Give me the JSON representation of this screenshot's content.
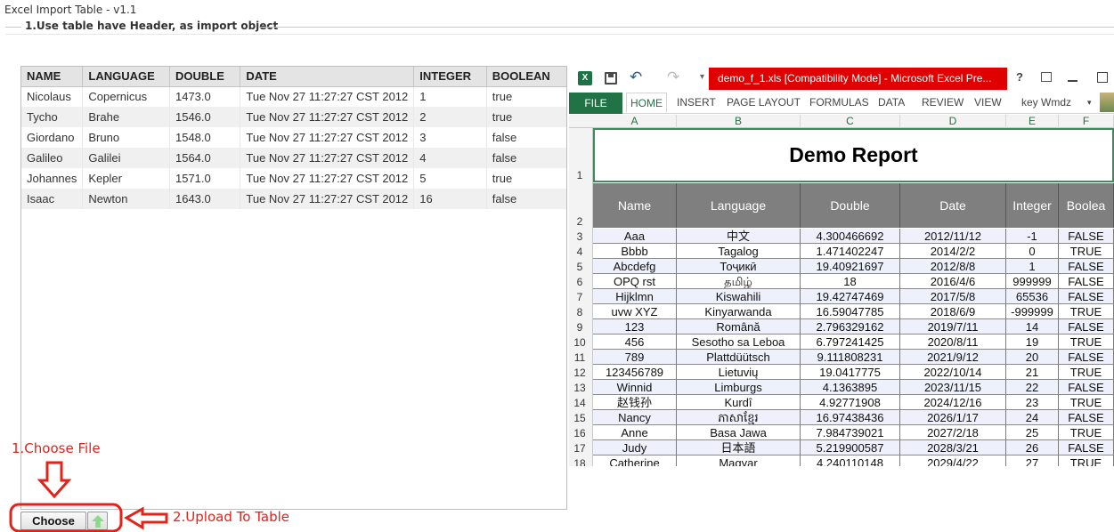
{
  "window": {
    "title": "Excel Import Table - v1.1"
  },
  "group": {
    "legend": "1.Use table have Header, as import object"
  },
  "table": {
    "columns": [
      "NAME",
      "LANGUAGE",
      "DOUBLE",
      "DATE",
      "INTEGER",
      "BOOLEAN"
    ],
    "rows": [
      [
        "Nicolaus",
        "Copernicus",
        "1473.0",
        "Tue Nov 27 11:27:27 CST 2012",
        "1",
        "true"
      ],
      [
        "Tycho",
        "Brahe",
        "1546.0",
        "Tue Nov 27 11:27:27 CST 2012",
        "2",
        "true"
      ],
      [
        "Giordano",
        "Bruno",
        "1548.0",
        "Tue Nov 27 11:27:27 CST 2012",
        "3",
        "false"
      ],
      [
        "Galileo",
        "Galilei",
        "1564.0",
        "Tue Nov 27 11:27:27 CST 2012",
        "4",
        "false"
      ],
      [
        "Johannes",
        "Kepler",
        "1571.0",
        "Tue Nov 27 11:27:27 CST 2012",
        "5",
        "true"
      ],
      [
        "Isaac",
        "Newton",
        "1643.0",
        "Tue Nov 27 11:27:27 CST 2012",
        "16",
        "false"
      ]
    ]
  },
  "buttons": {
    "choose_label": "Choose",
    "upload_icon": "upload-arrow-icon"
  },
  "annotations": {
    "choose_file": "1.Choose File",
    "upload_to_table": "2.Upload To Table"
  },
  "excel": {
    "title": "demo_f_1.xls  [Compatibility Mode] - Microsoft Excel Pre...",
    "help": "?",
    "ribbon_tabs": [
      "FILE",
      "HOME",
      "INSERT",
      "PAGE LAYOUT",
      "FORMULAS",
      "DATA",
      "REVIEW",
      "VIEW"
    ],
    "user": "key Wmdz",
    "column_letters": [
      "A",
      "B",
      "C",
      "D",
      "E",
      "F"
    ],
    "report_title": "Demo Report",
    "headers": [
      "Name",
      "Language",
      "Double",
      "Date",
      "Integer",
      "Boolea"
    ],
    "row_numbers": [
      "1",
      "2",
      "3",
      "4",
      "5",
      "6",
      "7",
      "8",
      "9",
      "10",
      "11",
      "12",
      "13",
      "14",
      "15",
      "16",
      "17",
      "18"
    ],
    "rows": [
      [
        "Aaa",
        "中文",
        "4.300466692",
        "2012/11/12",
        "-1",
        "FALSE"
      ],
      [
        "Bbbb",
        "Tagalog",
        "1.471402247",
        "2014/2/2",
        "0",
        "TRUE"
      ],
      [
        "Abcdefg",
        "Тоҷикӣ",
        "19.40921697",
        "2012/8/8",
        "1",
        "FALSE"
      ],
      [
        "OPQ rst",
        "தமிழ்",
        "18",
        "2016/4/6",
        "999999",
        "FALSE"
      ],
      [
        "Hijklmn",
        "Kiswahili",
        "19.42747469",
        "2017/5/8",
        "65536",
        "FALSE"
      ],
      [
        "uvw XYZ",
        "Kinyarwanda",
        "16.59047785",
        "2018/6/9",
        "-999999",
        "TRUE"
      ],
      [
        "123",
        "Română",
        "2.796329162",
        "2019/7/11",
        "14",
        "FALSE"
      ],
      [
        "456",
        "Sesotho sa Leboa",
        "6.797241425",
        "2020/8/11",
        "19",
        "TRUE"
      ],
      [
        "789",
        "Plattdüütsch",
        "9.111808231",
        "2021/9/12",
        "20",
        "FALSE"
      ],
      [
        "123456789",
        "Lietuvių",
        "19.0417775",
        "2022/10/14",
        "21",
        "TRUE"
      ],
      [
        "Winnid",
        "Limburgs",
        "4.1363895",
        "2023/11/15",
        "22",
        "FALSE"
      ],
      [
        "赵钱孙",
        "Kurdî",
        "4.92771908",
        "2024/12/16",
        "23",
        "TRUE"
      ],
      [
        "Nancy",
        "ភាសាខ្មែរ",
        "16.97438436",
        "2026/1/17",
        "24",
        "FALSE"
      ],
      [
        "Anne",
        "Basa Jawa",
        "7.984739021",
        "2027/2/18",
        "25",
        "TRUE"
      ],
      [
        "Judy",
        "日本語",
        "5.219900587",
        "2028/3/21",
        "26",
        "FALSE"
      ],
      [
        "Catherine",
        "Magyar",
        "4.240110148",
        "2029/4/22",
        "27",
        "TRUE"
      ]
    ]
  },
  "colors": {
    "annotation_red": "#e2231a",
    "excel_green": "#217346",
    "excel_title_red": "#e10000"
  }
}
